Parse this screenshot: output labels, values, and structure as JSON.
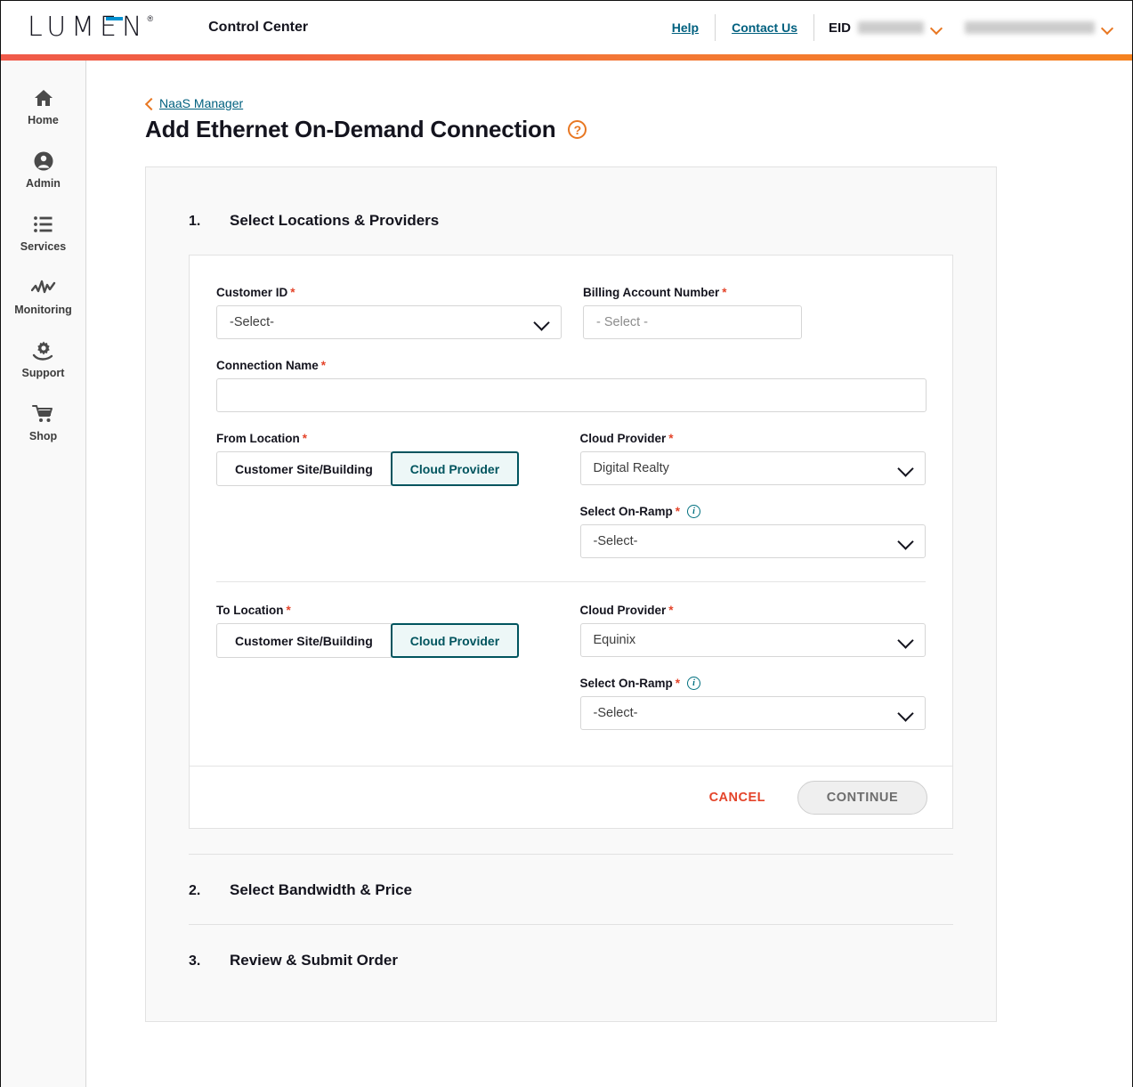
{
  "header": {
    "logo_text": "LUMEN",
    "logo_registered": "®",
    "app_title": "Control Center",
    "help_label": "Help",
    "contact_label": "Contact Us",
    "eid_label": "EID",
    "eid_value": "",
    "account_value": "",
    "accent_orange": "#e87722",
    "accent_teal": "#00607f"
  },
  "sidebar": {
    "items": [
      {
        "label": "Home",
        "icon": "home-icon"
      },
      {
        "label": "Admin",
        "icon": "user-circle-icon"
      },
      {
        "label": "Services",
        "icon": "list-icon"
      },
      {
        "label": "Monitoring",
        "icon": "activity-icon"
      },
      {
        "label": "Support",
        "icon": "gear-hand-icon"
      },
      {
        "label": "Shop",
        "icon": "cart-icon"
      }
    ]
  },
  "breadcrumb": {
    "link_label": "NaaS Manager",
    "chevron": "chevron-left-icon"
  },
  "page": {
    "title": "Add Ethernet On-Demand Connection",
    "help_icon": "help-circle-icon"
  },
  "steps": [
    {
      "number": "1.",
      "title": "Select Locations & Providers"
    },
    {
      "number": "2.",
      "title": "Select Bandwidth & Price"
    },
    {
      "number": "3.",
      "title": "Review & Submit Order"
    }
  ],
  "form": {
    "customer_id": {
      "label": "Customer ID",
      "required": "*",
      "value": "-Select-"
    },
    "billing_account": {
      "label": "Billing Account Number",
      "required": "*",
      "placeholder": "- Select -"
    },
    "connection_name": {
      "label": "Connection Name",
      "required": "*",
      "value": "",
      "placeholder": ""
    },
    "from_location": {
      "label": "From Location",
      "required": "*",
      "option_site": "Customer Site/Building",
      "option_cloud": "Cloud Provider",
      "selected": "Cloud Provider",
      "cloud_provider": {
        "label": "Cloud Provider",
        "required": "*",
        "value": "Digital Realty"
      },
      "on_ramp": {
        "label": "Select On-Ramp",
        "required": "*",
        "info_icon": "info-circle-icon",
        "value": "-Select-"
      }
    },
    "to_location": {
      "label": "To Location",
      "required": "*",
      "option_site": "Customer Site/Building",
      "option_cloud": "Cloud Provider",
      "selected": "Cloud Provider",
      "cloud_provider": {
        "label": "Cloud Provider",
        "required": "*",
        "value": "Equinix"
      },
      "on_ramp": {
        "label": "Select On-Ramp",
        "required": "*",
        "info_icon": "info-circle-icon",
        "value": "-Select-"
      }
    },
    "actions": {
      "cancel_label": "CANCEL",
      "continue_label": "CONTINUE"
    }
  }
}
